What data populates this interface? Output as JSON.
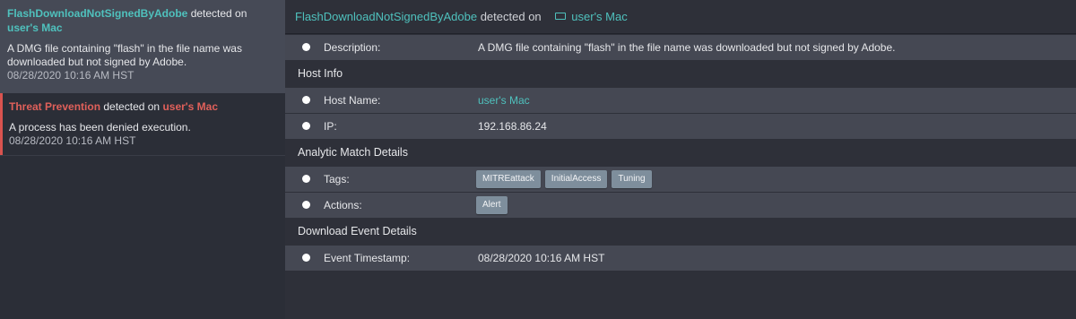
{
  "sidebar": {
    "alerts": [
      {
        "name": "FlashDownloadNotSignedByAdobe",
        "detected_on": "detected on",
        "host": "user's Mac",
        "description": "A DMG file containing \"flash\" in the file name was downloaded but not signed by Adobe.",
        "time": "08/28/2020 10:16 AM HST"
      },
      {
        "name": "Threat Prevention",
        "detected_on": "detected on",
        "host": "user's Mac",
        "description": "A process has been denied execution.",
        "time": "08/28/2020 10:16 AM HST"
      }
    ]
  },
  "detail": {
    "header": {
      "name": "FlashDownloadNotSignedByAdobe",
      "detected_on": "detected on",
      "host": "user's Mac"
    },
    "description_label": "Description:",
    "description_value": "A DMG file containing \"flash\" in the file name was downloaded but not signed by Adobe.",
    "host_info": {
      "title": "Host Info",
      "host_name_label": "Host Name:",
      "host_name_value": "user's Mac",
      "ip_label": "IP:",
      "ip_value": "192.168.86.24"
    },
    "analytic": {
      "title": "Analytic Match Details",
      "tags_label": "Tags:",
      "tags": [
        "MITREattack",
        "InitialAccess",
        "Tuning"
      ],
      "actions_label": "Actions:",
      "actions": [
        "Alert"
      ]
    },
    "download": {
      "title": "Download Event Details",
      "timestamp_label": "Event Timestamp:",
      "timestamp_value": "08/28/2020 10:16 AM HST"
    }
  },
  "colors": {
    "accent": "#4fc1bd",
    "danger": "#e0605a",
    "chip": "#7e8e9c"
  }
}
